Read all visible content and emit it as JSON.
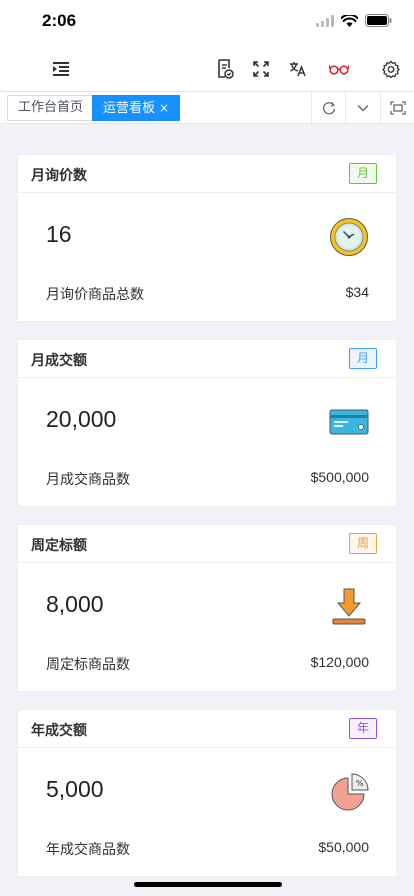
{
  "status": {
    "time": "2:06"
  },
  "toolbar": {
    "icons": [
      "menu-indent-icon",
      "document-check-icon",
      "fullscreen-icon",
      "translate-icon",
      "glasses-icon",
      "settings-gear-icon"
    ],
    "accent": "#e0262d"
  },
  "tabs": {
    "items": [
      {
        "label": "工作台首页",
        "active": false
      },
      {
        "label": "运营看板",
        "active": true,
        "close": "×"
      }
    ],
    "active_color": "#1890ff"
  },
  "cards": [
    {
      "title": "月询价数",
      "badge": "月",
      "badge_color": "#67c23a",
      "value": "16",
      "icon": "clock-icon",
      "footer_label": "月询价商品总数",
      "footer_value": "$34"
    },
    {
      "title": "月成交额",
      "badge": "月",
      "badge_color": "#409eff",
      "value": "20,000",
      "icon": "credit-card-icon",
      "footer_label": "月成交商品数",
      "footer_value": "$500,000"
    },
    {
      "title": "周定标额",
      "badge": "周",
      "badge_color": "#e6a23c",
      "value": "8,000",
      "icon": "download-arrow-icon",
      "footer_label": "周定标商品数",
      "footer_value": "$120,000"
    },
    {
      "title": "年成交额",
      "badge": "年",
      "badge_color": "#9254de",
      "value": "5,000",
      "icon": "pie-chart-icon",
      "footer_label": "年成交商品数",
      "footer_value": "$50,000"
    }
  ]
}
